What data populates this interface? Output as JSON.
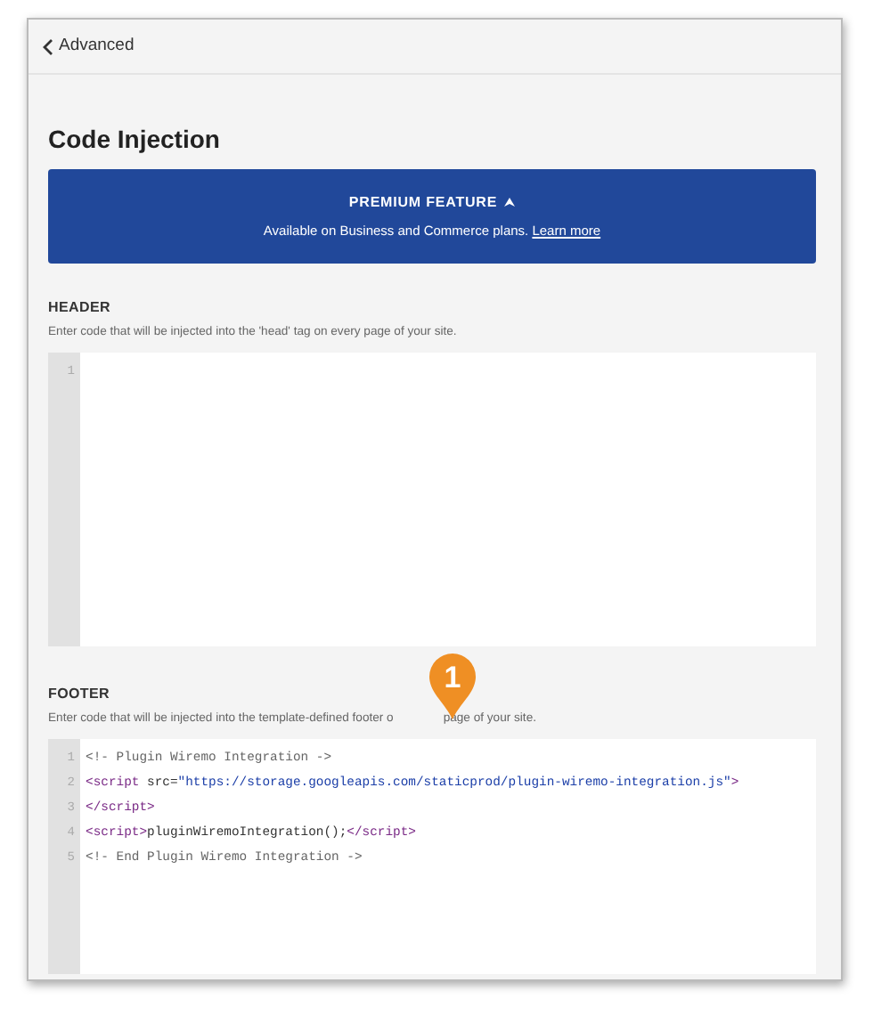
{
  "back_link": {
    "label": "Advanced"
  },
  "title": "Code Injection",
  "premium_banner": {
    "heading": "PREMIUM FEATURE",
    "text": "Available on Business and Commerce plans.",
    "link": "Learn more"
  },
  "sections": [
    {
      "heading": "HEADER",
      "description": [
        "Enter code that will be injected into the 'head' tag on every page of your site."
      ],
      "editor": {
        "lines": [
          {
            "number": "1"
          }
        ]
      }
    },
    {
      "heading": "FOOTER",
      "description": [
        "Enter code that will be injected into the template-defined footer o",
        "page of your site."
      ],
      "marker": "1",
      "editor": {
        "lines": [
          {
            "number": "1",
            "tokens": [
              {
                "kind": "comment",
                "text": "<!- Plugin Wiremo Integration ->"
              }
            ]
          },
          {
            "number": "2",
            "tokens": [
              {
                "kind": "tag",
                "text": "<script "
              },
              {
                "kind": "attr",
                "text": "src="
              },
              {
                "kind": "string",
                "text": "\"https://storage.googleapis.com/staticprod/plugin-wiremo-integration.js\""
              },
              {
                "kind": "tag",
                "text": ">"
              }
            ]
          },
          {
            "number": "3",
            "tokens": [
              {
                "kind": "tag",
                "text": "</script>"
              }
            ]
          },
          {
            "number": "4",
            "tokens": [
              {
                "kind": "tag",
                "text": "<script>"
              },
              {
                "kind": "plain",
                "text": "pluginWiremoIntegration();"
              },
              {
                "kind": "tag",
                "text": "</script>"
              }
            ]
          },
          {
            "number": "5",
            "tokens": [
              {
                "kind": "comment",
                "text": "<!- End Plugin Wiremo Integration ->"
              }
            ]
          }
        ]
      }
    }
  ]
}
